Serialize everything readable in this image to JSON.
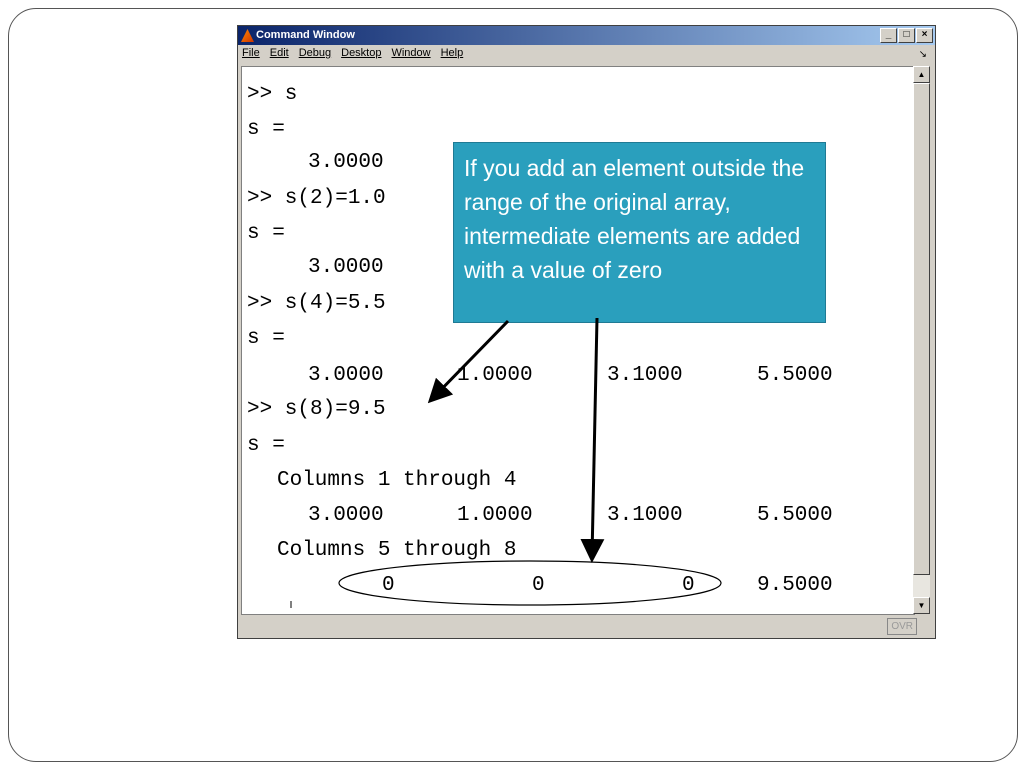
{
  "window": {
    "title": "Command Window",
    "menu": [
      "File",
      "Edit",
      "Debug",
      "Desktop",
      "Window",
      "Help"
    ],
    "status": "OVR"
  },
  "console": {
    "l1": ">> s",
    "l2": "s =",
    "l3": "3.0000",
    "l4": ">> s(2)=1.0",
    "l5": "s =",
    "l6": "3.0000",
    "l7": ">> s(4)=5.5",
    "l8": "s =",
    "r9": [
      "3.0000",
      "1.0000",
      "3.1000",
      "5.5000"
    ],
    "l10": ">> s(8)=9.5",
    "l11": "s =",
    "l12": "Columns 1 through 4",
    "r13": [
      "3.0000",
      "1.0000",
      "3.1000",
      "5.5000"
    ],
    "l14": "Columns 5 through 8",
    "r15": [
      "0",
      "0",
      "0",
      "9.5000"
    ]
  },
  "callout": "If you add an element outside the range of the original array, intermediate elements are added with a value of zero"
}
